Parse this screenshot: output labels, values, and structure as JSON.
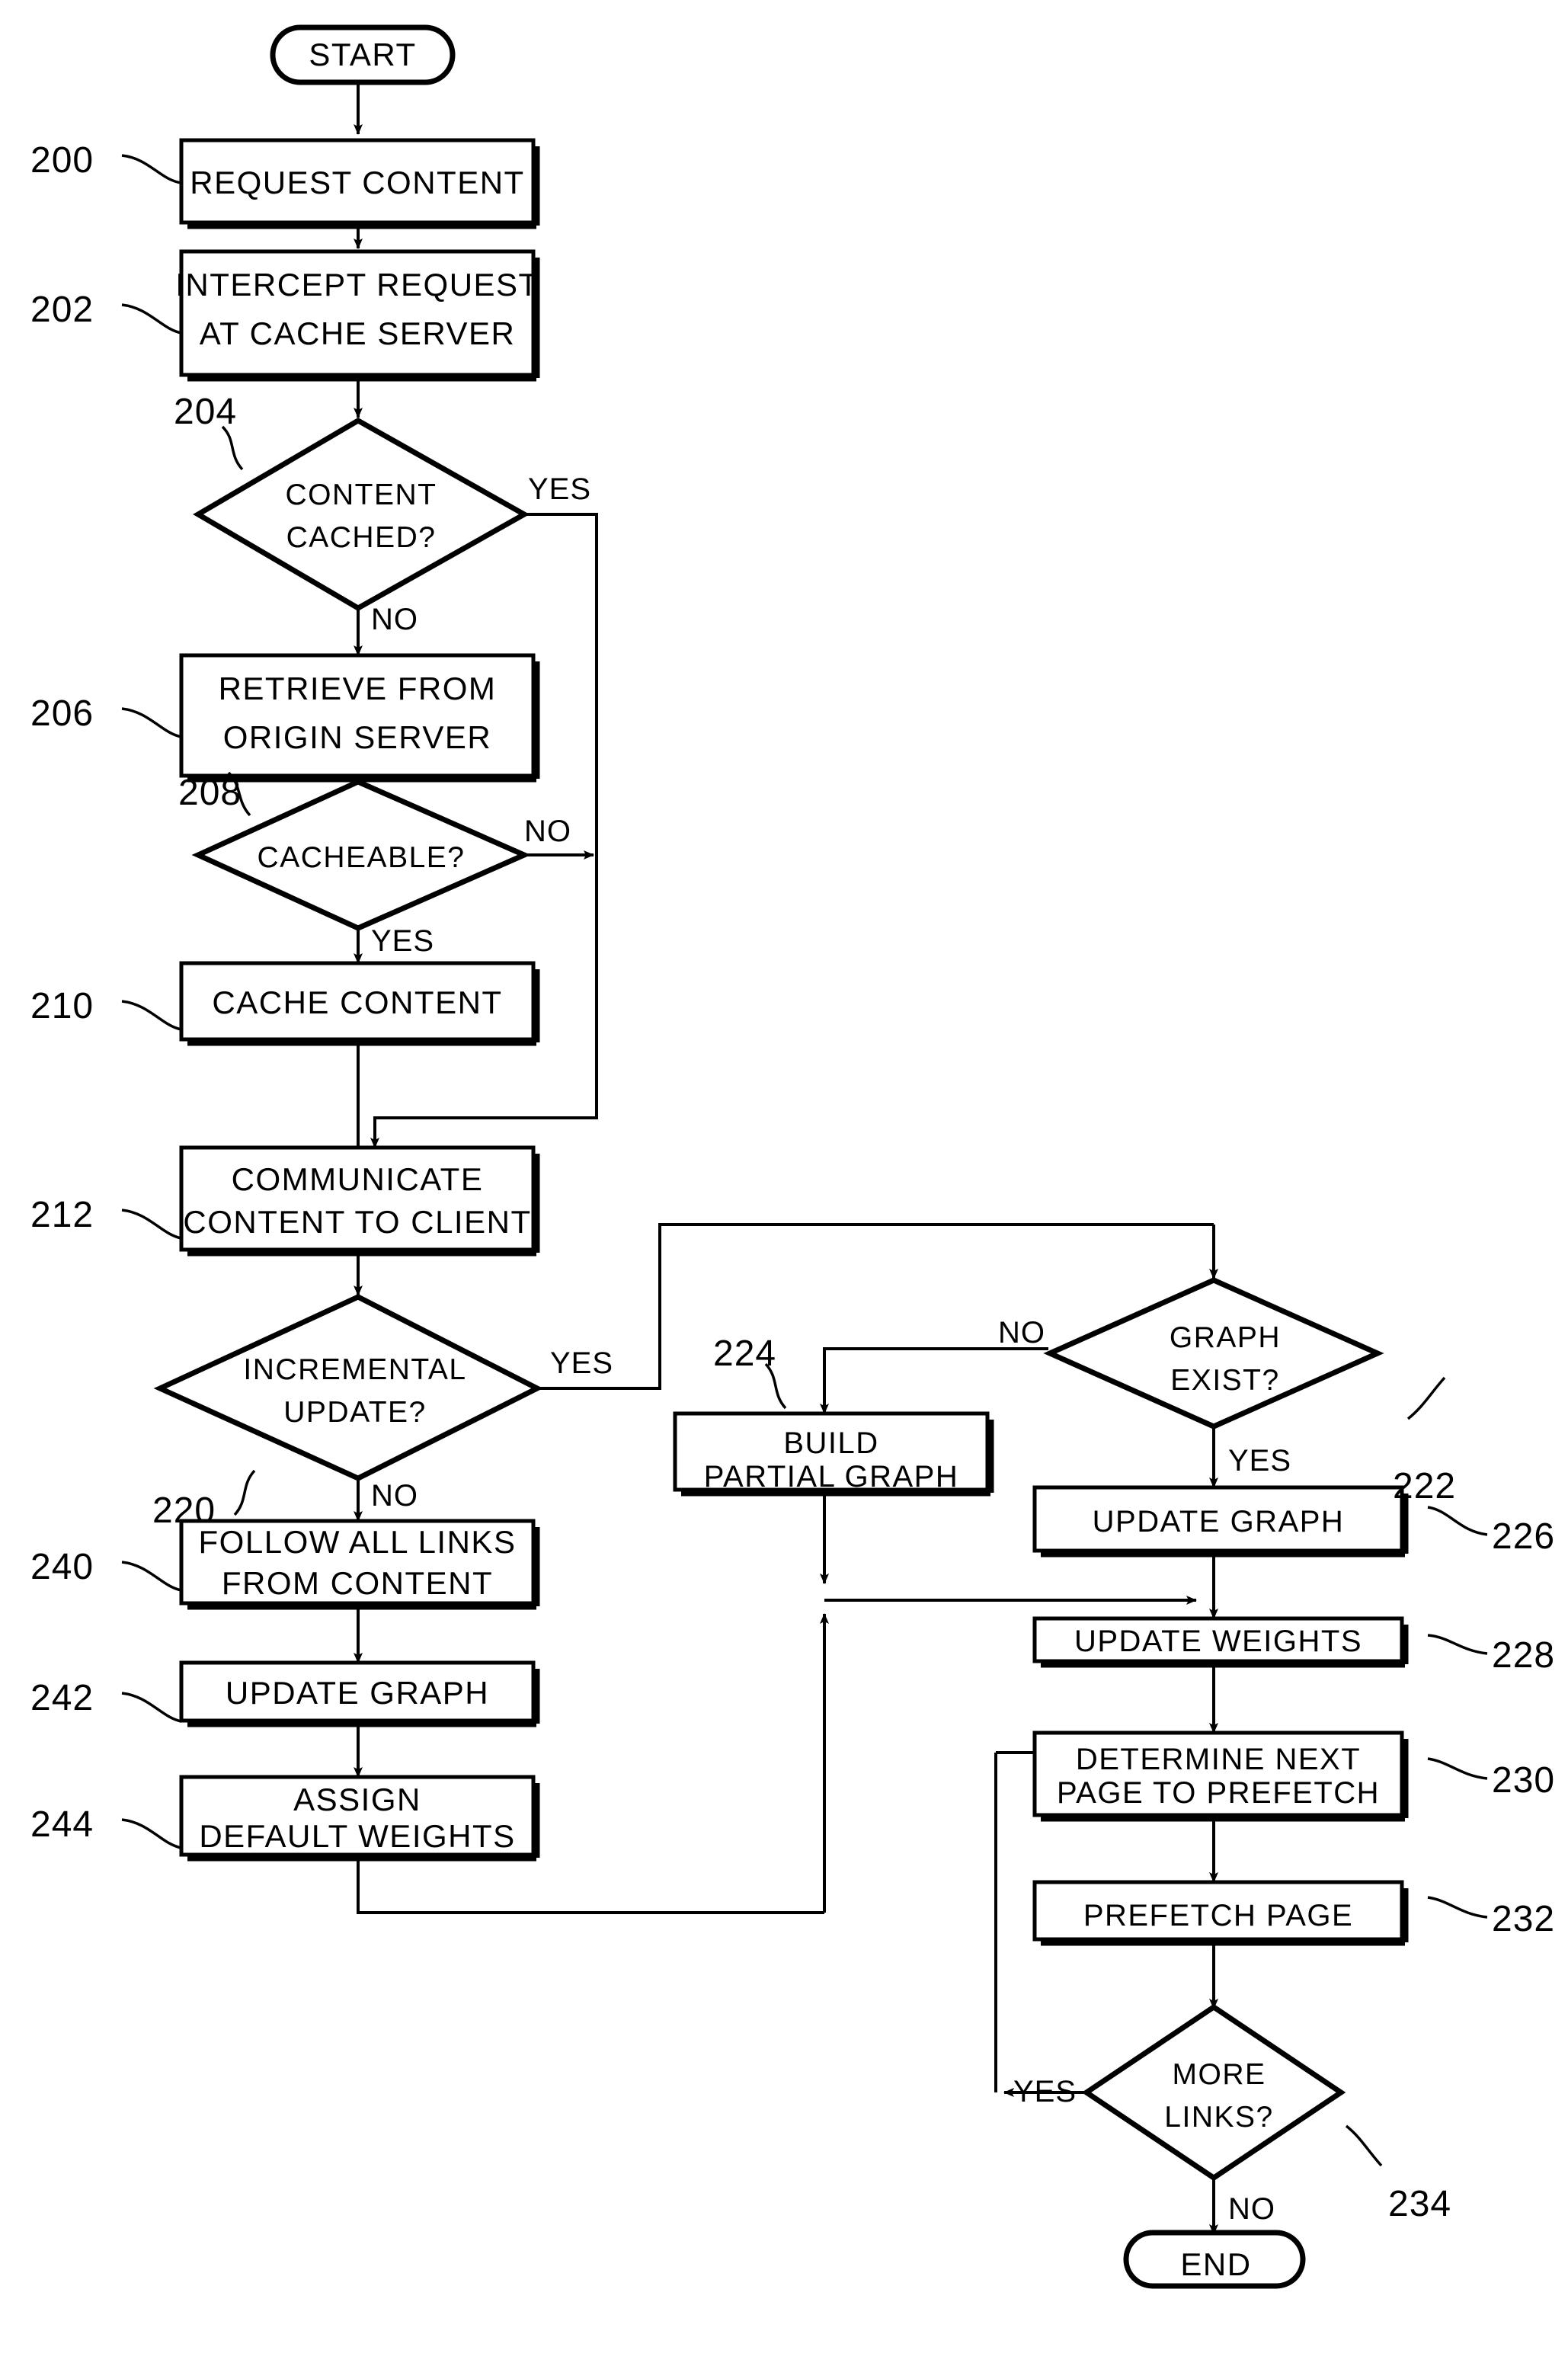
{
  "figure": {
    "type": "patent-flowchart",
    "terminators": {
      "start": "START",
      "end": "END"
    },
    "nodes": [
      {
        "id": "n200",
        "ref": "200",
        "shape": "process",
        "label_lines": [
          "REQUEST CONTENT"
        ]
      },
      {
        "id": "n202",
        "ref": "202",
        "shape": "process",
        "label_lines": [
          "INTERCEPT REQUEST",
          "AT CACHE SERVER"
        ]
      },
      {
        "id": "n204",
        "ref": "204",
        "shape": "decision",
        "label_lines": [
          "CONTENT",
          "CACHED?"
        ]
      },
      {
        "id": "n206",
        "ref": "206",
        "shape": "process",
        "label_lines": [
          "RETRIEVE FROM",
          "ORIGIN SERVER"
        ]
      },
      {
        "id": "n208",
        "ref": "208",
        "shape": "decision",
        "label_lines": [
          "CACHEABLE?"
        ]
      },
      {
        "id": "n210",
        "ref": "210",
        "shape": "process",
        "label_lines": [
          "CACHE CONTENT"
        ]
      },
      {
        "id": "n212",
        "ref": "212",
        "shape": "process",
        "label_lines": [
          "COMMUNICATE",
          "CONTENT TO CLIENT"
        ]
      },
      {
        "id": "n220",
        "ref": "220",
        "shape": "decision",
        "label_lines": [
          "INCREMENTAL",
          "UPDATE?"
        ]
      },
      {
        "id": "n222",
        "ref": "222",
        "shape": "decision",
        "label_lines": [
          "GRAPH",
          "EXIST?"
        ]
      },
      {
        "id": "n224",
        "ref": "224",
        "shape": "process",
        "label_lines": [
          "BUILD",
          "PARTIAL GRAPH"
        ]
      },
      {
        "id": "n226",
        "ref": "226",
        "shape": "process",
        "label_lines": [
          "UPDATE GRAPH"
        ]
      },
      {
        "id": "n228",
        "ref": "228",
        "shape": "process",
        "label_lines": [
          "UPDATE WEIGHTS"
        ]
      },
      {
        "id": "n230",
        "ref": "230",
        "shape": "process",
        "label_lines": [
          "DETERMINE NEXT",
          "PAGE TO PREFETCH"
        ]
      },
      {
        "id": "n232",
        "ref": "232",
        "shape": "process",
        "label_lines": [
          "PREFETCH PAGE"
        ]
      },
      {
        "id": "n234",
        "ref": "234",
        "shape": "decision",
        "label_lines": [
          "MORE",
          "LINKS?"
        ]
      },
      {
        "id": "n240",
        "ref": "240",
        "shape": "process",
        "label_lines": [
          "FOLLOW ALL LINKS",
          "FROM CONTENT"
        ]
      },
      {
        "id": "n242",
        "ref": "242",
        "shape": "process",
        "label_lines": [
          "UPDATE GRAPH"
        ]
      },
      {
        "id": "n244",
        "ref": "244",
        "shape": "process",
        "label_lines": [
          "ASSIGN",
          "DEFAULT WEIGHTS"
        ]
      }
    ],
    "edge_labels": {
      "e204_yes": "YES",
      "e204_no": "NO",
      "e208_no": "NO",
      "e208_yes": "YES",
      "e220_yes": "YES",
      "e220_no": "NO",
      "e222_no": "NO",
      "e222_yes": "YES",
      "e234_yes": "YES",
      "e234_no": "NO"
    },
    "colors": {
      "ink": "#000000",
      "paper": "#ffffff"
    }
  }
}
